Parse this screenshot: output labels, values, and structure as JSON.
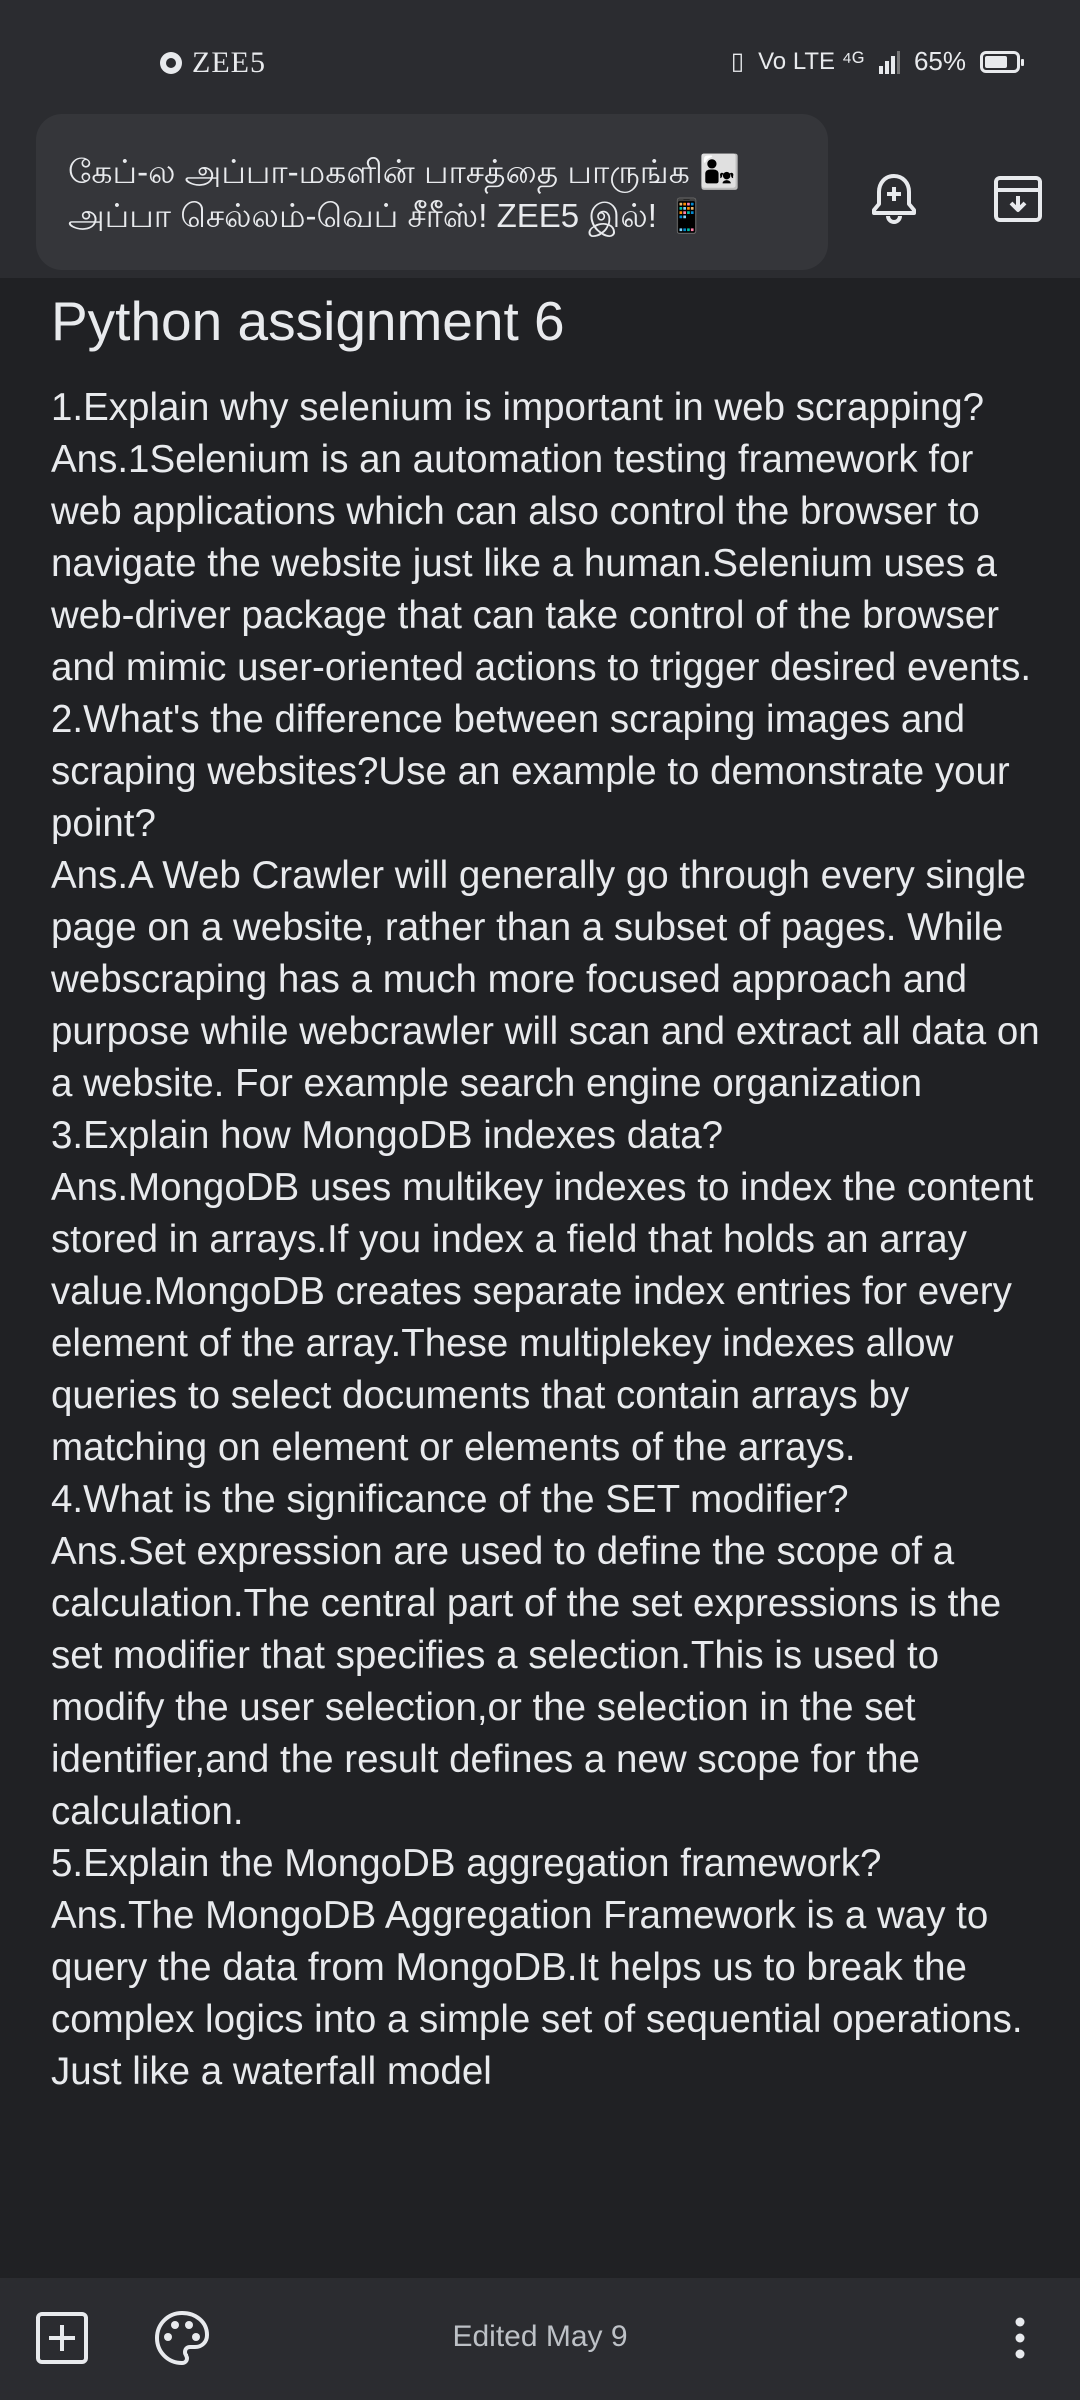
{
  "status_bar": {
    "app_name": "ZEE5",
    "signal_text": "Vo LTE ⁴ᴳ",
    "battery": "65%"
  },
  "ad": {
    "line1": "கேப்-ல அப்பா-மகளின் பாசத்தை பாருங்க 👨‍👧",
    "line2": "அப்பா செல்லம்-வெப் சீரீஸ்! ZEE5 இல்! 📱"
  },
  "note": {
    "title": "Python assignment 6",
    "body": "1.Explain why selenium is important in web scrapping?\nAns.1Selenium is an automation testing framework for web applications which can also control the browser to navigate the website just like a human.Selenium uses a web-driver package that can take control of the browser and mimic user-oriented actions to trigger desired events.\n2.What's the difference between scraping images and scraping websites?Use an example to demonstrate your point?\nAns.A Web Crawler will generally go through every single page on a website, rather than a subset of pages. While webscraping has a much more focused approach and purpose while webcrawler will scan and extract all data on a website. For example search engine organization\n3.Explain how MongoDB indexes data?\nAns.MongoDB uses multikey indexes to index the content stored in arrays.If you index a field that holds an array value.MongoDB creates separate index entries for every element of the array.These multiplekey indexes allow queries to select documents that contain arrays by matching on element or elements of the arrays.\n4.What is the significance of the SET modifier?\nAns.Set expression are used to define the scope of a calculation.The central part of the set expressions is the set modifier that specifies a selection.This is used to modify the user selection,or the selection in the set identifier,and the result defines a new scope for the calculation.\n5.Explain the MongoDB aggregation framework?\nAns.The MongoDB Aggregation Framework is a way to query the data from MongoDB.It helps us to break the complex logics into a simple set of sequential operations. Just like a waterfall model"
  },
  "bottom_bar": {
    "edited_label": "Edited May 9"
  }
}
